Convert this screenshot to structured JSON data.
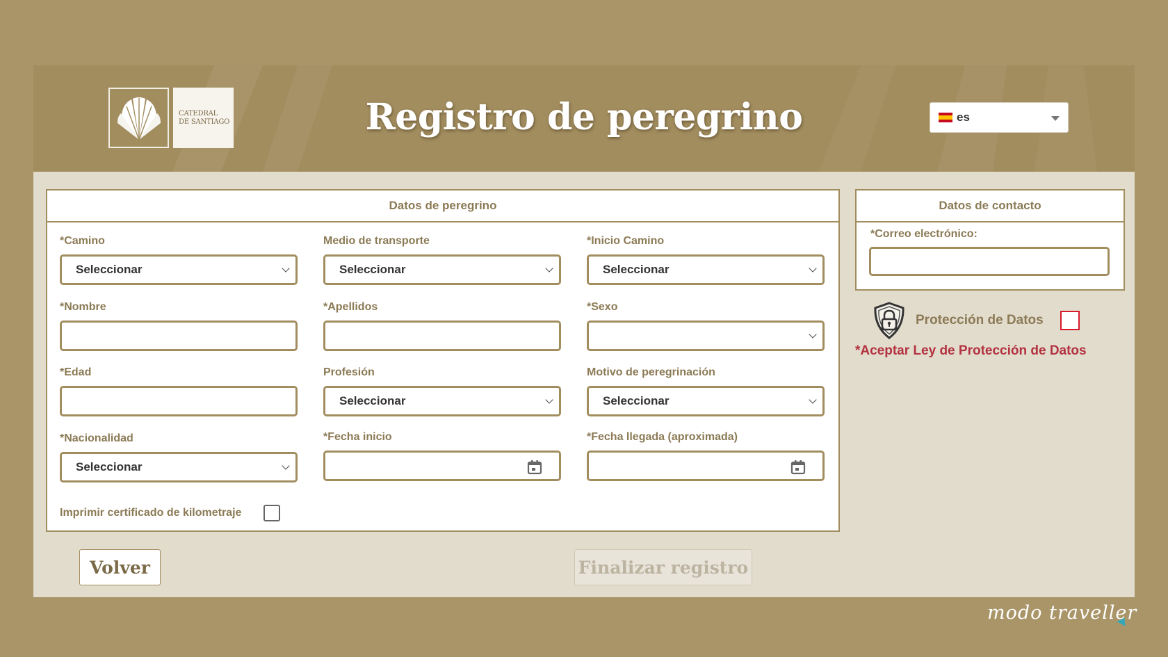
{
  "header": {
    "logo_line1": "CATEDRAL",
    "logo_line2": "DE SANTIAGO",
    "title": "Registro de peregrino",
    "language": {
      "value": "es",
      "flag": "spain-flag-icon"
    }
  },
  "pilgrim_panel": {
    "heading": "Datos de peregrino",
    "fields": {
      "camino": {
        "label": "*Camino",
        "value": "Seleccionar"
      },
      "transporte": {
        "label": "Medio de transporte",
        "value": "Seleccionar"
      },
      "inicio": {
        "label": "*Inicio Camino",
        "value": "Seleccionar"
      },
      "nombre": {
        "label": "*Nombre",
        "value": ""
      },
      "apellidos": {
        "label": "*Apellidos",
        "value": ""
      },
      "sexo": {
        "label": "*Sexo",
        "value": ""
      },
      "edad": {
        "label": "*Edad",
        "value": ""
      },
      "profesion": {
        "label": "Profesión",
        "value": "Seleccionar"
      },
      "motivo": {
        "label": "Motivo de peregrinación",
        "value": "Seleccionar"
      },
      "nacionalidad": {
        "label": "*Nacionalidad",
        "value": "Seleccionar"
      },
      "fecha_inicio": {
        "label": "*Fecha inicio",
        "value": ""
      },
      "fecha_llegada": {
        "label": "*Fecha llegada (aproximada)",
        "value": ""
      }
    },
    "certificate_label": "Imprimir certificado de kilometraje",
    "certificate_checked": false
  },
  "contact_panel": {
    "heading": "Datos de contacto",
    "email_label": "*Correo electrónico:",
    "email_value": ""
  },
  "privacy": {
    "label": "Protección de Datos",
    "checked": false,
    "warning": "*Aceptar Ley de Protección de Datos"
  },
  "buttons": {
    "back": "Volver",
    "finish": "Finalizar registro"
  },
  "watermark": "modo traveller",
  "colors": {
    "background": "#a99568",
    "header": "#a28d5f",
    "panel_border": "#a28d5f",
    "label_text": "#8b7a55",
    "warning_text": "#b33240",
    "checkbox_error": "#d7192b"
  }
}
